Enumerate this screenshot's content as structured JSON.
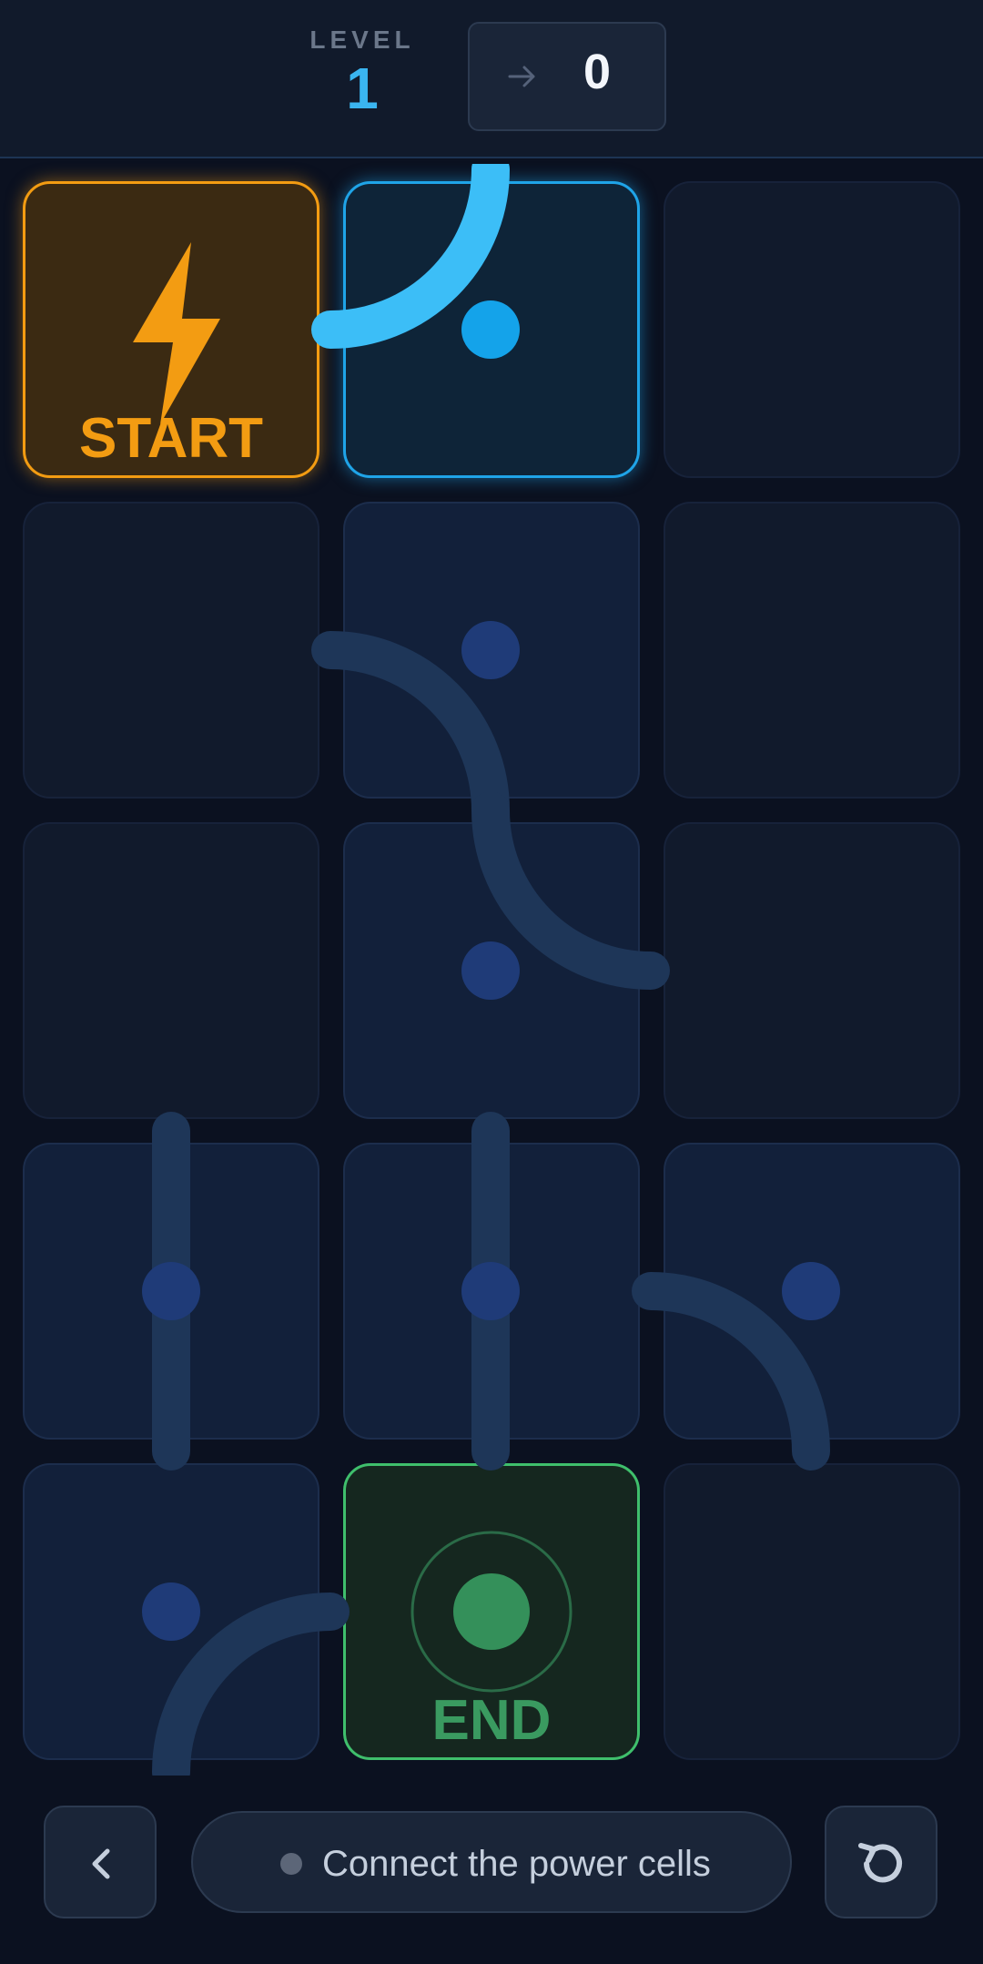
{
  "header": {
    "level_label": "LEVEL",
    "level_value": "1",
    "moves_icon": "arrow-right-icon",
    "moves_value": "0"
  },
  "board": {
    "rows": 5,
    "cols": 3,
    "tiles": [
      {
        "row": 0,
        "col": 0,
        "kind": "start",
        "label": "START",
        "icon": "lightning-bolt-icon"
      },
      {
        "row": 0,
        "col": 1,
        "kind": "powered",
        "piece": "curve"
      },
      {
        "row": 0,
        "col": 2,
        "kind": "empty"
      },
      {
        "row": 1,
        "col": 0,
        "kind": "empty"
      },
      {
        "row": 1,
        "col": 1,
        "kind": "pipe",
        "piece": "curve"
      },
      {
        "row": 1,
        "col": 2,
        "kind": "empty"
      },
      {
        "row": 2,
        "col": 0,
        "kind": "empty"
      },
      {
        "row": 2,
        "col": 1,
        "kind": "pipe",
        "piece": "curve"
      },
      {
        "row": 2,
        "col": 2,
        "kind": "empty"
      },
      {
        "row": 3,
        "col": 0,
        "kind": "pipe",
        "piece": "straight"
      },
      {
        "row": 3,
        "col": 1,
        "kind": "pipe",
        "piece": "straight"
      },
      {
        "row": 3,
        "col": 2,
        "kind": "pipe",
        "piece": "curve"
      },
      {
        "row": 4,
        "col": 0,
        "kind": "pipe",
        "piece": "curve"
      },
      {
        "row": 4,
        "col": 1,
        "kind": "end",
        "label": "END",
        "icon": "target-icon"
      },
      {
        "row": 4,
        "col": 2,
        "kind": "empty"
      }
    ]
  },
  "footer": {
    "back_icon": "chevron-left-icon",
    "status_text": "Connect the power cells",
    "reset_icon": "reset-icon"
  },
  "colors": {
    "background": "#0b1120",
    "powered": "#3cbef7",
    "pipe": "#1e3658",
    "start": "#f39c12",
    "end": "#3fbf6c"
  }
}
